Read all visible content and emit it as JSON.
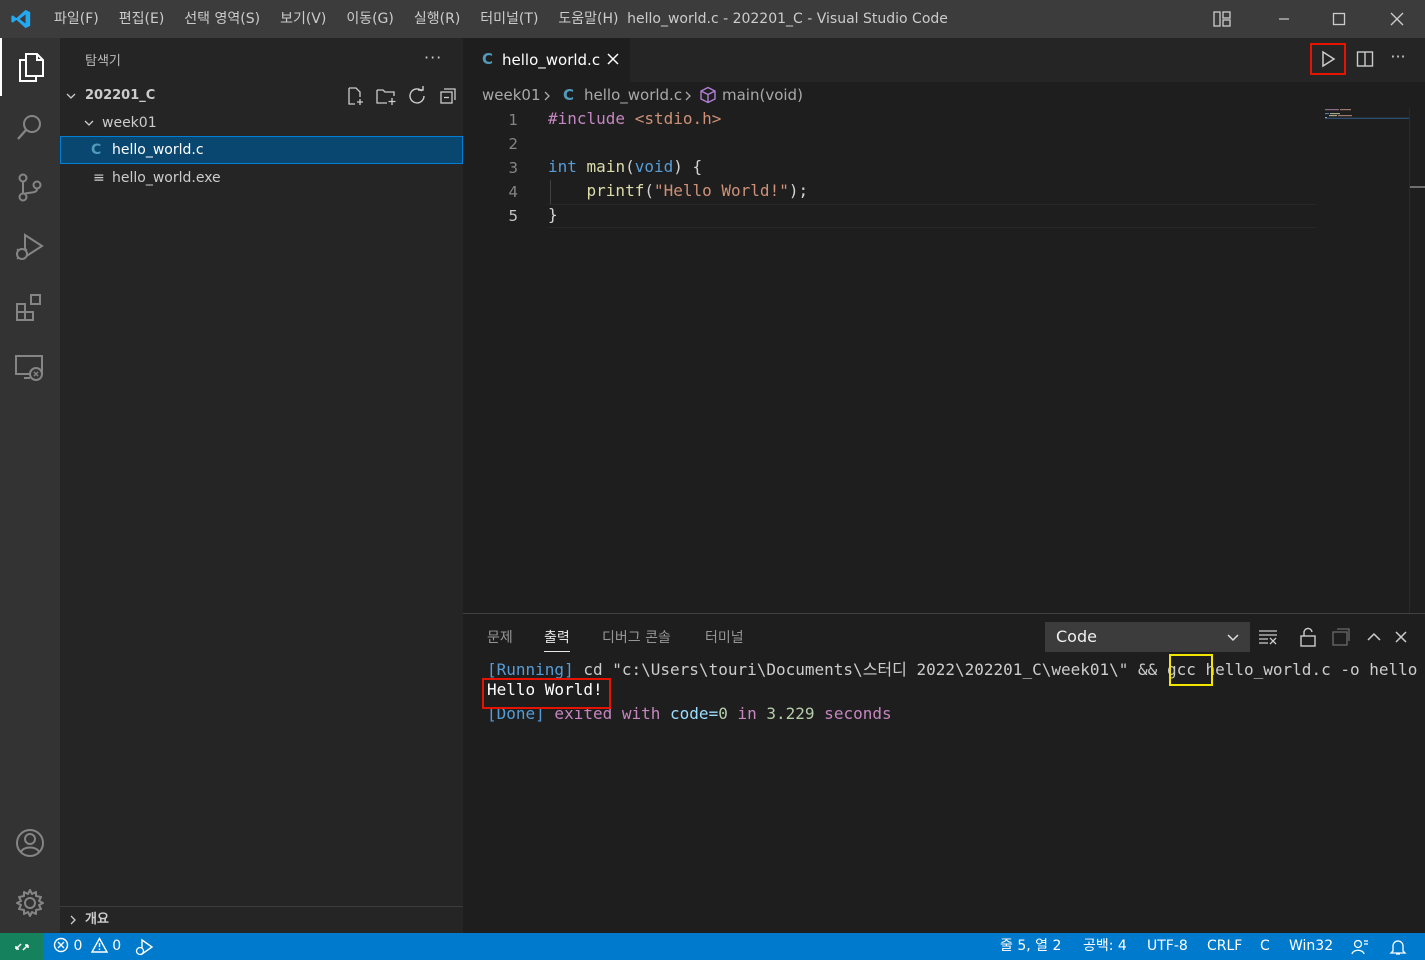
{
  "titlebar": {
    "menu": [
      "파일(F)",
      "편집(E)",
      "선택 영역(S)",
      "보기(V)",
      "이동(G)",
      "실행(R)",
      "터미널(T)",
      "도움말(H)"
    ],
    "window_title": "hello_world.c - 202201_C - Visual Studio Code"
  },
  "sidebar": {
    "title": "탐색기",
    "more": "···",
    "folder": "202201_C",
    "subfolder": "week01",
    "files": [
      {
        "icon": "C",
        "name": "hello_world.c",
        "selected": true
      },
      {
        "icon": "≡",
        "name": "hello_world.exe",
        "selected": false
      }
    ],
    "outline": "개요"
  },
  "tab": {
    "icon": "C",
    "label": "hello_world.c"
  },
  "editor_more": "···",
  "breadcrumb": [
    "week01",
    "hello_world.c",
    "main(void)"
  ],
  "editor": {
    "line_numbers": [
      "1",
      "2",
      "3",
      "4",
      "5"
    ],
    "lines": [
      [
        {
          "t": "#include ",
          "c": "pp"
        },
        {
          "t": "<stdio.h>",
          "c": "inc"
        }
      ],
      [],
      [
        {
          "t": "int",
          "c": "kw"
        },
        {
          "t": " "
        },
        {
          "t": "main",
          "c": "fn"
        },
        {
          "t": "("
        },
        {
          "t": "void",
          "c": "kw"
        },
        {
          "t": ") {"
        }
      ],
      [
        {
          "t": "    "
        },
        {
          "t": "printf",
          "c": "fn"
        },
        {
          "t": "("
        },
        {
          "t": "\"Hello World!\"",
          "c": "str"
        },
        {
          "t": ");"
        }
      ],
      [
        {
          "t": "}"
        }
      ]
    ]
  },
  "panel": {
    "tabs": [
      "문제",
      "출력",
      "디버그 콘솔",
      "터미널"
    ],
    "active_tab": "출력",
    "channel": "Code",
    "output": [
      [
        {
          "t": "[Running]",
          "c": "blue"
        },
        {
          "t": " cd \"c:\\Users\\touri\\Documents\\스터디 2022\\202201_C\\week01\\\" && "
        },
        {
          "t": "gcc"
        },
        {
          "t": " hello_world.c -o hello"
        }
      ],
      [
        {
          "t": "Hello World!",
          "c": "white"
        }
      ],
      [
        {
          "t": "[Done]",
          "c": "blue"
        },
        {
          "t": " exited with ",
          "c": "purple"
        },
        {
          "t": "code=",
          "c": "kv"
        },
        {
          "t": "0",
          "c": "num"
        },
        {
          "t": " in ",
          "c": "purple"
        },
        {
          "t": "3.229",
          "c": "num"
        },
        {
          "t": " seconds",
          "c": "purple"
        }
      ]
    ]
  },
  "statusbar": {
    "errors": "0",
    "warnings": "0",
    "position": "줄 5, 열 2",
    "indent": "공백: 4",
    "encoding": "UTF-8",
    "eol": "CRLF",
    "language": "C",
    "config": "Win32"
  },
  "colors": {
    "accent": "#007acc",
    "highlight_red": "#e51400",
    "highlight_yellow": "#f2e600",
    "selection": "#094771"
  }
}
